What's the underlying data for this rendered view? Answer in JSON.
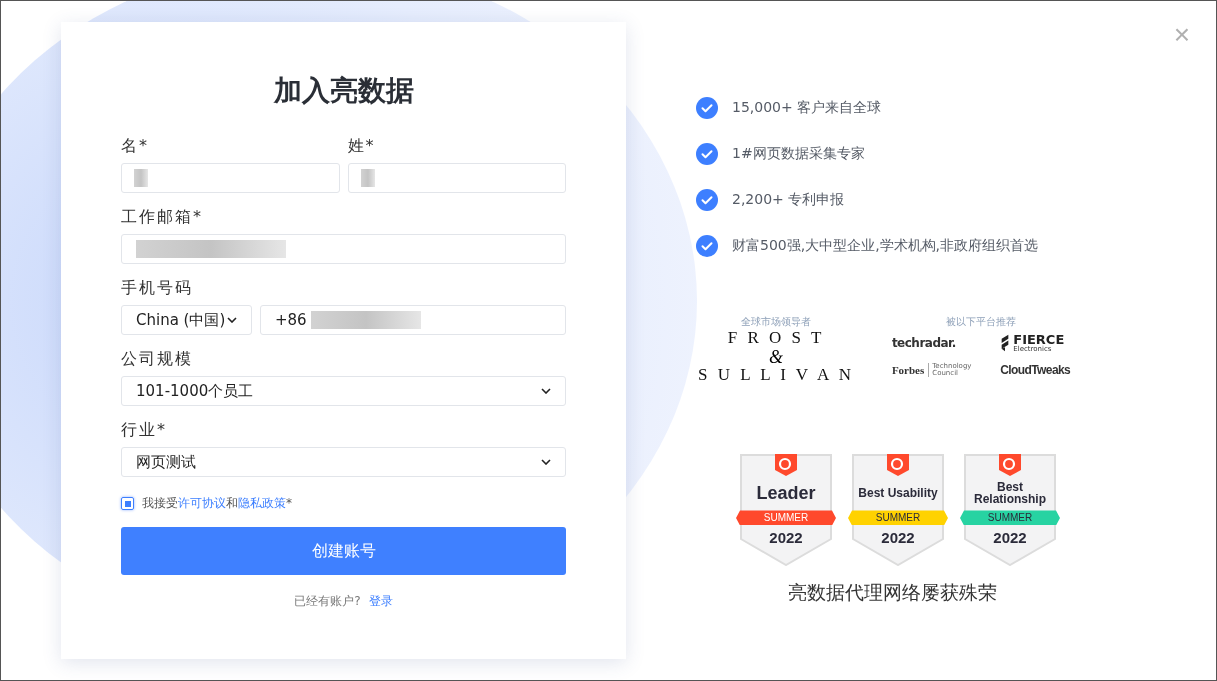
{
  "dialog": {
    "close": "×"
  },
  "form": {
    "title": "加入亮数据",
    "first_name": {
      "label": "名*"
    },
    "last_name": {
      "label": "姓*"
    },
    "email": {
      "label": "工作邮箱*"
    },
    "phone": {
      "label": "手机号码",
      "country": "China (中国)",
      "value": "+86"
    },
    "company_size": {
      "label": "公司规模",
      "value": "101-1000个员工"
    },
    "industry": {
      "label": "行业*",
      "value": "网页测试"
    },
    "consent": {
      "checked": true,
      "text": "我接受",
      "link_1": "许可协议",
      "joiner": "和",
      "link_2": "隐私政策",
      "suffix": "*"
    },
    "submit": "创建账号",
    "login_prompt": "已经有账户?",
    "login_link": "登录"
  },
  "benefits": [
    "15,000+ 客户来自全球",
    "1#网页数据采集专家",
    "2,200+ 专利申报",
    "财富500强,大中型企业,学术机构,非政府组织首选"
  ],
  "recognition": {
    "leader_caption": "全球市场领导者",
    "frost_top": "F R O S T",
    "frost_amp": "&",
    "frost_bottom": "S U L L I V A N",
    "media_caption": "被以下平台推荐",
    "media": [
      {
        "kind": "techradar",
        "name": "techradar."
      },
      {
        "kind": "fierce",
        "name": "FIERCE",
        "sub": "Electronics"
      },
      {
        "kind": "forbes",
        "name": "Forbes",
        "sub": "Technology Council"
      },
      {
        "kind": "cloudtweaks",
        "name": "CloudTweaks"
      }
    ]
  },
  "badges": [
    {
      "title": "Leader",
      "season": "SUMMER",
      "year": "2022",
      "color": "#ff492c"
    },
    {
      "title": "Best Usability",
      "season": "SUMMER",
      "year": "2022",
      "color": "#ffd200"
    },
    {
      "title": "Best Relationship",
      "season": "SUMMER",
      "year": "2022",
      "color": "#27d3a2"
    }
  ],
  "awards_caption": "亮数据代理网络屡获殊荣"
}
